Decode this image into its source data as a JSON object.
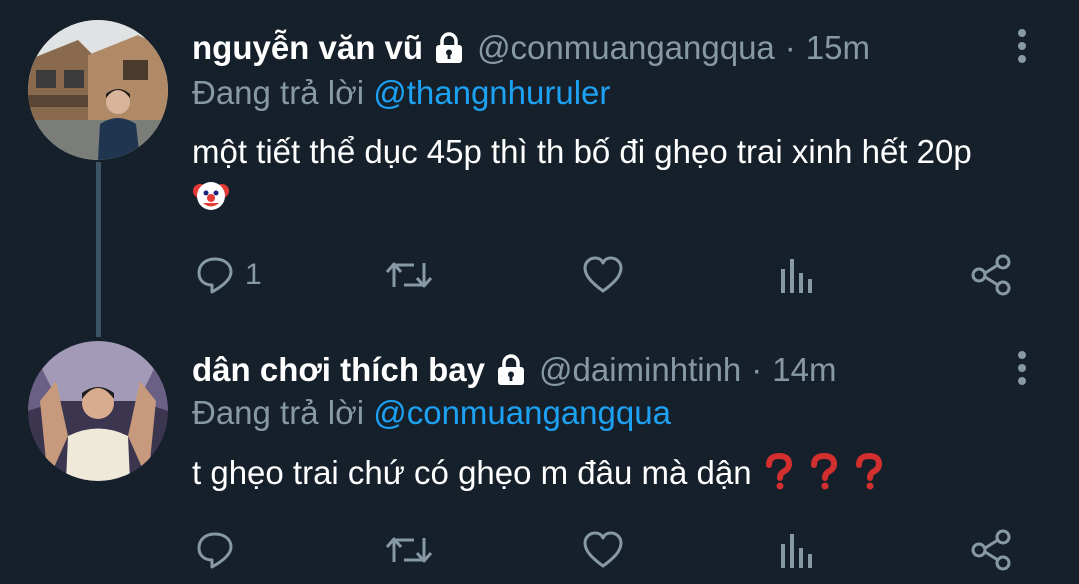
{
  "colors": {
    "background": "#15202b",
    "text": "#ffffff",
    "muted": "#8899a6",
    "link": "#1da1f2",
    "thread_line": "#3d5466"
  },
  "tweets": [
    {
      "display_name": "nguyễn văn vũ",
      "protected_icon": "lock-icon",
      "handle": "@conmuangangqua",
      "separator": "·",
      "timestamp": "15m",
      "reply_prefix": "Đang trả lời",
      "reply_to": "@thangnhuruler",
      "text": "một tiết thể dục 45p thì th bố đi ghẹo trai xinh hết 20p",
      "emoji": "clown-face-emoji",
      "reply_count": "1",
      "icons": [
        "reply-icon",
        "retweet-icon",
        "like-icon",
        "stats-icon",
        "share-icon"
      ]
    },
    {
      "display_name": "dân chơi thích bay",
      "protected_icon": "lock-icon",
      "handle": "@daiminhtinh",
      "separator": "·",
      "timestamp": "14m",
      "reply_prefix": "Đang trả lời",
      "reply_to": "@conmuangangqua",
      "text": "t ghẹo trai chứ có ghẹo m đâu mà dận",
      "emoji": "red-question-mark-emoji",
      "reply_count": "",
      "icons": [
        "reply-icon",
        "retweet-icon",
        "like-icon",
        "stats-icon",
        "share-icon"
      ]
    }
  ]
}
